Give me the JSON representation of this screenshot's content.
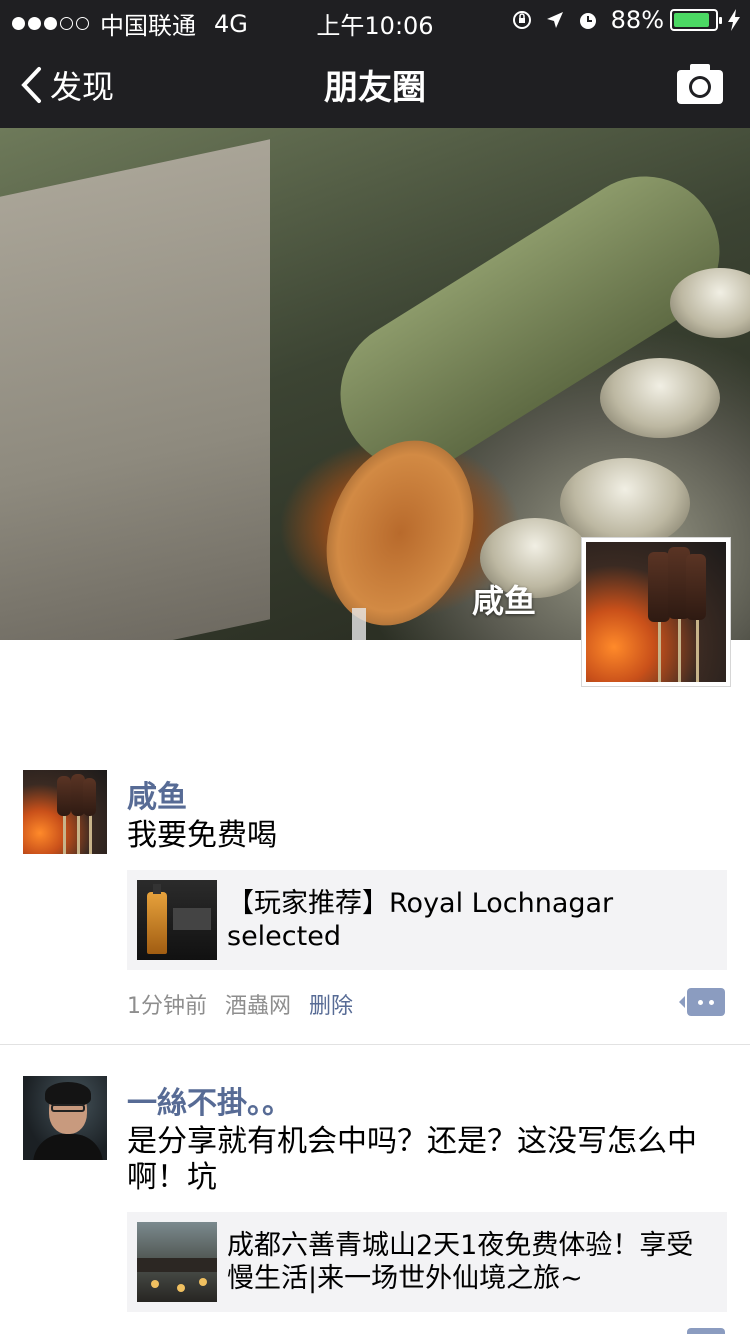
{
  "status_bar": {
    "signal_dots": 5,
    "signal_filled": 3,
    "carrier": "中国联通",
    "network": "4G",
    "time": "上午10:06",
    "battery_percent_text": "88%",
    "battery_level": 0.88,
    "icons": [
      "rotation-lock-icon",
      "location-arrow-icon",
      "alarm-icon",
      "battery-icon",
      "charging-bolt-icon"
    ]
  },
  "nav": {
    "back_label": "发现",
    "title": "朋友圈",
    "camera_icon": "camera-icon"
  },
  "cover": {
    "username": "咸鱼"
  },
  "feed": [
    {
      "name": "咸鱼",
      "text": "我要免费喝",
      "link_title": "【玩家推荐】Royal Lochnagar selected",
      "time": "1分钟前",
      "source": "酒蟲网",
      "delete_label": "删除"
    },
    {
      "name": "一絲不掛。。",
      "text": "是分享就有机会中吗？还是？这没写怎么中啊！坑",
      "link_title": "成都六善青城山2天1夜免费体验！享受慢生活|来一场世外仙境之旅~"
    }
  ],
  "colors": {
    "bar_bg": "#1f1f22",
    "name_link": "#576b95",
    "meta_gray": "#8e8e8e",
    "card_bg": "#f3f3f5",
    "battery_green": "#4cd964"
  }
}
